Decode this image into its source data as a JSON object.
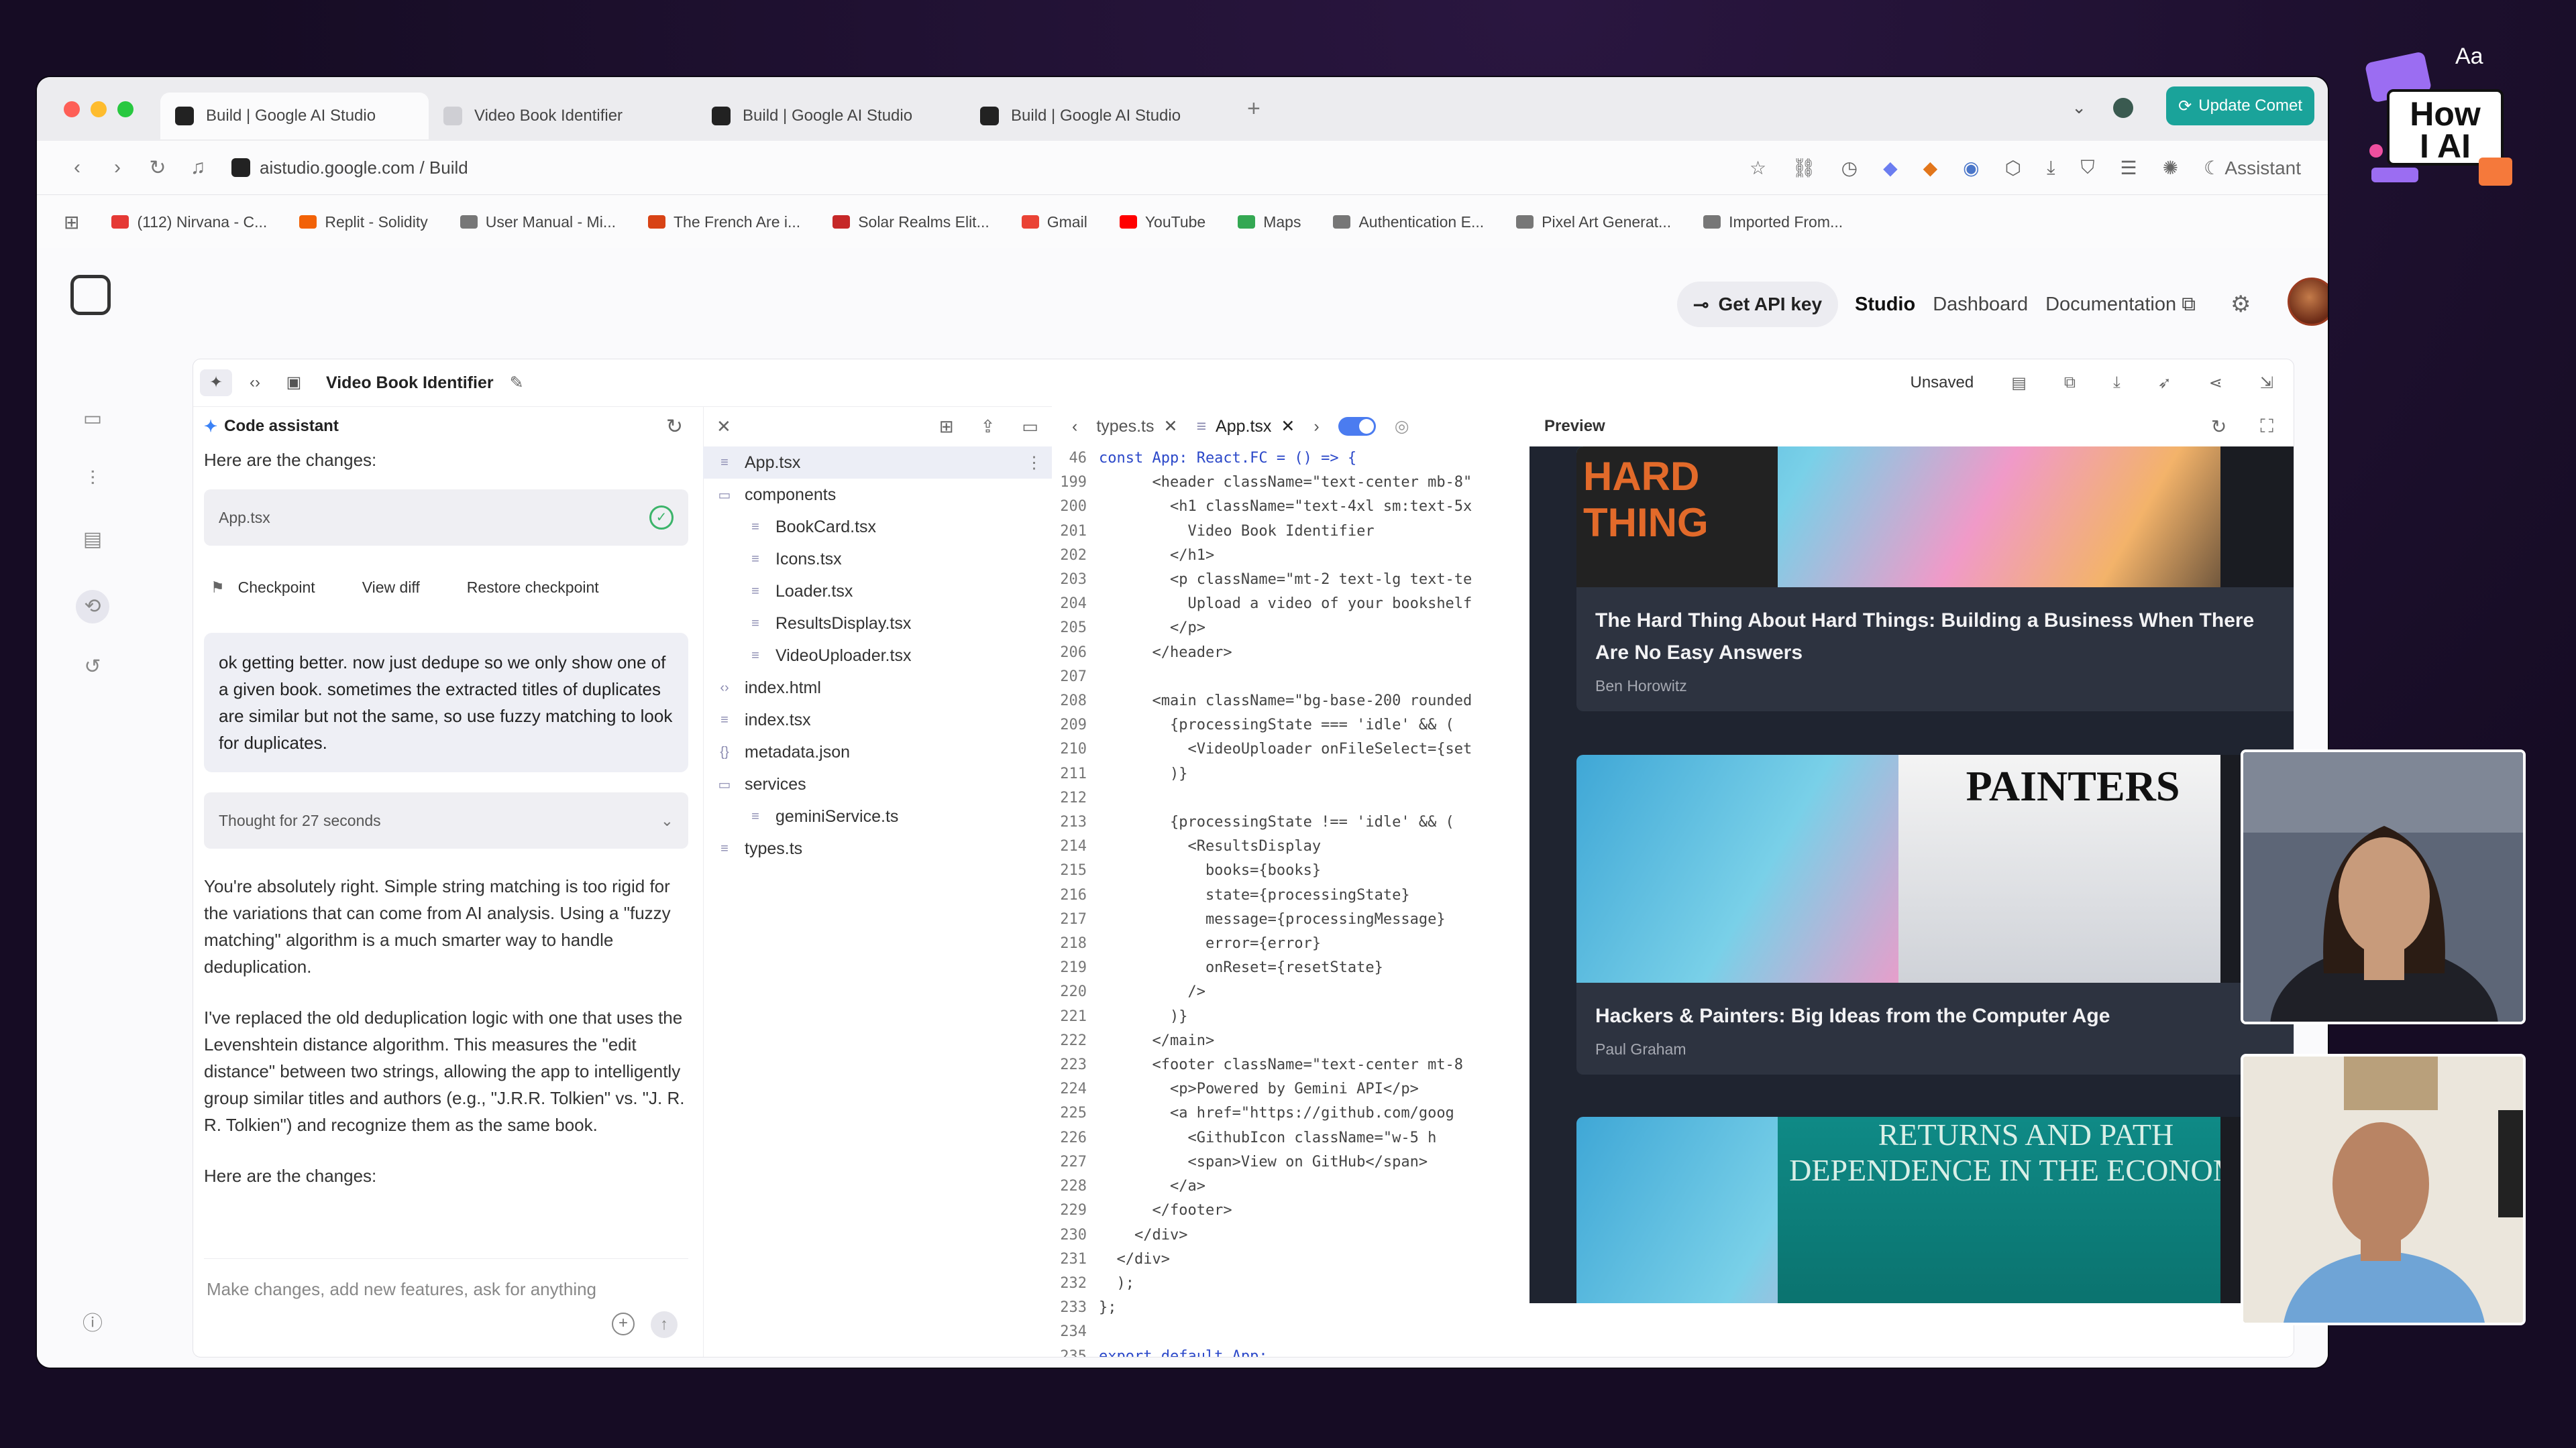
{
  "browser": {
    "tabs": [
      {
        "label": "Build | Google AI Studio",
        "active": true
      },
      {
        "label": "Video Book Identifier",
        "active": false
      },
      {
        "label": "Build | Google AI Studio",
        "active": false
      },
      {
        "label": "Build | Google AI Studio",
        "active": false
      }
    ],
    "update_label": "Update Comet",
    "url": "aistudio.google.com / Build",
    "assistant_label": "Assistant",
    "bookmarks": [
      {
        "label": "(112) Nirvana - C...",
        "color": "#e53935"
      },
      {
        "label": "Replit - Solidity",
        "color": "#f26207"
      },
      {
        "label": "User Manual - Mi...",
        "color": "#777777"
      },
      {
        "label": "The French Are i...",
        "color": "#d84315"
      },
      {
        "label": "Solar Realms Elit...",
        "color": "#c62828"
      },
      {
        "label": "Gmail",
        "color": "#ea4335"
      },
      {
        "label": "YouTube",
        "color": "#ff0000"
      },
      {
        "label": "Maps",
        "color": "#34a853"
      },
      {
        "label": "Authentication E...",
        "color": "#777777"
      },
      {
        "label": "Pixel Art Generat...",
        "color": "#777777"
      },
      {
        "label": "Imported From...",
        "color": "#777777"
      }
    ]
  },
  "header": {
    "get_api_key": "Get API key",
    "nav": [
      "Studio",
      "Dashboard",
      "Documentation"
    ]
  },
  "workspace": {
    "project_title": "Video Book Identifier",
    "status": "Unsaved"
  },
  "chat": {
    "title": "Code assistant",
    "intro": "Here are the changes:",
    "file_chip": "App.tsx",
    "checkpoint_label": "Checkpoint",
    "view_diff": "View diff",
    "restore_checkpoint": "Restore checkpoint",
    "user_message": "ok getting better. now just dedupe so we only show one of a given book. sometimes the extracted titles of duplicates are similar but not the same, so use fuzzy matching to look for duplicates.",
    "thought": "Thought for 27 seconds",
    "reply_1": "You're absolutely right. Simple string matching is too rigid for the variations that can come from AI analysis. Using a \"fuzzy matching\" algorithm is a much smarter way to handle deduplication.",
    "reply_2": "I've replaced the old deduplication logic with one that uses the Levenshtein distance algorithm. This measures the \"edit distance\" between two strings, allowing the app to intelligently group similar titles and authors (e.g., \"J.R.R. Tolkien\" vs. \"J. R. R. Tolkien\") and recognize them as the same book.",
    "outro": "Here are the changes:",
    "input_placeholder": "Make changes, add new features, ask for anything"
  },
  "files": [
    {
      "name": "App.tsx",
      "kind": "file",
      "depth": 0,
      "selected": true
    },
    {
      "name": "components",
      "kind": "folder",
      "depth": 0
    },
    {
      "name": "BookCard.tsx",
      "kind": "file",
      "depth": 1
    },
    {
      "name": "Icons.tsx",
      "kind": "file",
      "depth": 1
    },
    {
      "name": "Loader.tsx",
      "kind": "file",
      "depth": 1
    },
    {
      "name": "ResultsDisplay.tsx",
      "kind": "file",
      "depth": 1
    },
    {
      "name": "VideoUploader.tsx",
      "kind": "file",
      "depth": 1
    },
    {
      "name": "index.html",
      "kind": "html",
      "depth": 0
    },
    {
      "name": "index.tsx",
      "kind": "file",
      "depth": 0
    },
    {
      "name": "metadata.json",
      "kind": "json",
      "depth": 0
    },
    {
      "name": "services",
      "kind": "folder",
      "depth": 0
    },
    {
      "name": "geminiService.ts",
      "kind": "file",
      "depth": 1
    },
    {
      "name": "types.ts",
      "kind": "file",
      "depth": 0
    }
  ],
  "editor": {
    "tabs": [
      "types.ts",
      "App.tsx"
    ],
    "lines": [
      {
        "n": "46",
        "t": "const App: React.FC = () => {",
        "kw": true
      },
      {
        "n": "199",
        "t": "      <header className=\"text-center mb-8\""
      },
      {
        "n": "200",
        "t": "        <h1 className=\"text-4xl sm:text-5x"
      },
      {
        "n": "201",
        "t": "          Video Book Identifier"
      },
      {
        "n": "202",
        "t": "        </h1>"
      },
      {
        "n": "203",
        "t": "        <p className=\"mt-2 text-lg text-te"
      },
      {
        "n": "204",
        "t": "          Upload a video of your bookshelf"
      },
      {
        "n": "205",
        "t": "        </p>"
      },
      {
        "n": "206",
        "t": "      </header>"
      },
      {
        "n": "207",
        "t": ""
      },
      {
        "n": "208",
        "t": "      <main className=\"bg-base-200 rounded"
      },
      {
        "n": "209",
        "t": "        {processingState === 'idle' && ("
      },
      {
        "n": "210",
        "t": "          <VideoUploader onFileSelect={set"
      },
      {
        "n": "211",
        "t": "        )}"
      },
      {
        "n": "212",
        "t": ""
      },
      {
        "n": "213",
        "t": "        {processingState !== 'idle' && ("
      },
      {
        "n": "214",
        "t": "          <ResultsDisplay"
      },
      {
        "n": "215",
        "t": "            books={books}"
      },
      {
        "n": "216",
        "t": "            state={processingState}"
      },
      {
        "n": "217",
        "t": "            message={processingMessage}"
      },
      {
        "n": "218",
        "t": "            error={error}"
      },
      {
        "n": "219",
        "t": "            onReset={resetState}"
      },
      {
        "n": "220",
        "t": "          />"
      },
      {
        "n": "221",
        "t": "        )}"
      },
      {
        "n": "222",
        "t": "      </main>"
      },
      {
        "n": "223",
        "t": "      <footer className=\"text-center mt-8"
      },
      {
        "n": "224",
        "t": "        <p>Powered by Gemini API</p>"
      },
      {
        "n": "225",
        "t": "        <a href=\"https://github.com/goog"
      },
      {
        "n": "226",
        "t": "          <GithubIcon className=\"w-5 h"
      },
      {
        "n": "227",
        "t": "          <span>View on GitHub</span>"
      },
      {
        "n": "228",
        "t": "        </a>"
      },
      {
        "n": "229",
        "t": "      </footer>"
      },
      {
        "n": "230",
        "t": "    </div>"
      },
      {
        "n": "231",
        "t": "  </div>"
      },
      {
        "n": "232",
        "t": "  );"
      },
      {
        "n": "233",
        "t": "};"
      },
      {
        "n": "234",
        "t": ""
      },
      {
        "n": "235",
        "t": "export default App;",
        "kw": true
      }
    ]
  },
  "preview": {
    "title": "Preview",
    "books": [
      {
        "title": "The Hard Thing About Hard Things: Building a Business When There Are No Easy Answers",
        "author": "Ben Horowitz",
        "spine_text": "HARD THING"
      },
      {
        "title": "Hackers & Painters: Big Ideas from the Computer Age",
        "author": "Paul Graham",
        "spine_text": "PAINTERS"
      },
      {
        "title": "",
        "author": "",
        "spine_text": "RETURNS AND PATH DEPENDENCE IN THE ECONOMY"
      }
    ]
  },
  "overlay": {
    "logo_line1": "How",
    "logo_line2": "I AI",
    "logo_corner": "Aa"
  }
}
